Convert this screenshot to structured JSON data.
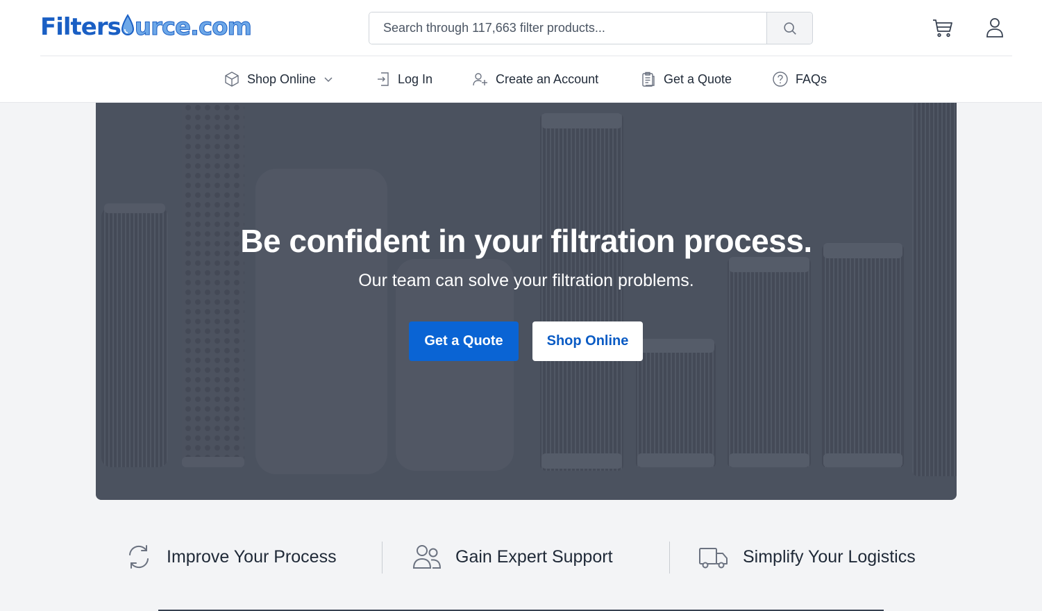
{
  "brand": {
    "logo_part1": "Filters",
    "logo_part2": "urce.com",
    "colors": {
      "primary": "#0a64d4",
      "logo_dark": "#1a5fc4",
      "logo_light": "#6ea8e8",
      "hero_overlay": "#4c5260"
    }
  },
  "header": {
    "search": {
      "placeholder": "Search through 117,663 filter products...",
      "value": "",
      "button_icon": "search-icon"
    },
    "actions": [
      {
        "icon": "cart-icon"
      },
      {
        "icon": "user-icon"
      }
    ]
  },
  "nav": {
    "items": [
      {
        "label": "Shop Online",
        "icon": "box-icon",
        "has_dropdown": true
      },
      {
        "label": "Log In",
        "icon": "login-icon"
      },
      {
        "label": "Create an Account",
        "icon": "add-user-icon"
      },
      {
        "label": "Get a Quote",
        "icon": "clipboard-icon"
      },
      {
        "label": "FAQs",
        "icon": "question-circle-icon"
      }
    ]
  },
  "hero": {
    "title": "Be confident in your filtration process.",
    "subtitle": "Our team can solve your filtration problems.",
    "primary_button": "Get a Quote",
    "secondary_button": "Shop Online"
  },
  "features": [
    {
      "label": "Improve Your Process",
      "icon": "refresh-icon"
    },
    {
      "label": "Gain Expert Support",
      "icon": "users-icon"
    },
    {
      "label": "Simplify Your Logistics",
      "icon": "truck-icon"
    }
  ]
}
